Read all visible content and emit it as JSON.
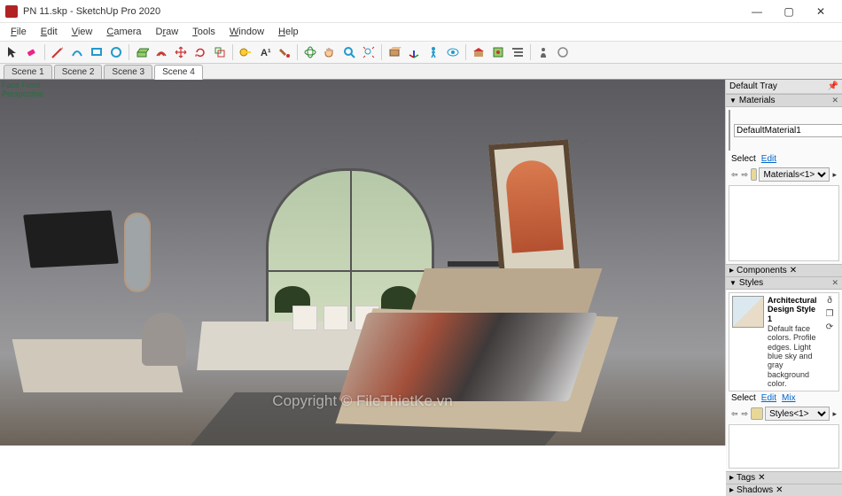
{
  "title": "PN 11.skp - SketchUp Pro 2020",
  "menu": [
    "File",
    "Edit",
    "View",
    "Camera",
    "Draw",
    "Tools",
    "Window",
    "Help"
  ],
  "scenes": [
    "Scene 1",
    "Scene 2",
    "Scene 3",
    "Scene 4"
  ],
  "active_scene": 3,
  "viewport_label_line1": "Face Front",
  "viewport_label_line2": "Perspective",
  "watermark": "Copyright © FileThietKe.vn",
  "brand": {
    "part1": "File",
    "part2": "Thiết Kế",
    "part3": ".vn"
  },
  "tray": {
    "title": "Default Tray",
    "materials": {
      "title": "Materials",
      "current_name": "DefaultMaterial1",
      "tabs": [
        "Select",
        "Edit"
      ],
      "list_name": "Materials<1>"
    },
    "components": {
      "title": "Components"
    },
    "styles": {
      "title": "Styles",
      "name": "Architectural Design Style 1",
      "desc": "Default face colors. Profile edges. Light blue sky and gray background color.",
      "tabs": [
        "Select",
        "Edit",
        "Mix"
      ],
      "list_name": "Styles<1>"
    },
    "tags": {
      "title": "Tags"
    },
    "shadows": {
      "title": "Shadows"
    }
  },
  "toolbar_icons": [
    "select",
    "eraser",
    "line",
    "rect",
    "arc",
    "circle",
    "pushpull",
    "offset",
    "move",
    "rotate",
    "scale",
    "tape",
    "text",
    "dim",
    "paint",
    "orbit",
    "pan",
    "zoom",
    "zoomext",
    "section",
    "walk",
    "look",
    "undo",
    "redo",
    "lock",
    "show",
    "hide",
    "layer",
    "3dw",
    "vray",
    "sun",
    "person"
  ]
}
